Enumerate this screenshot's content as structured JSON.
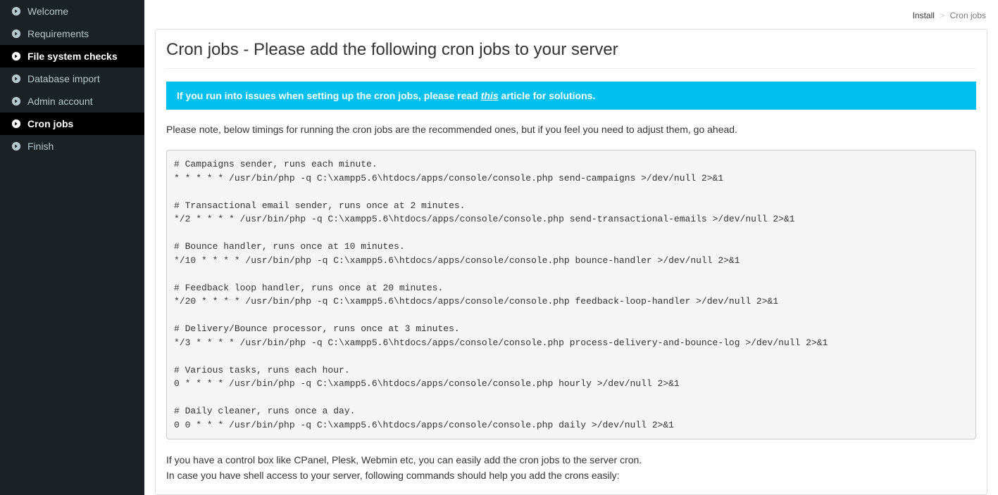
{
  "sidebar": {
    "items": [
      {
        "label": "Welcome",
        "active": false
      },
      {
        "label": "Requirements",
        "active": false
      },
      {
        "label": "File system checks",
        "active": true
      },
      {
        "label": "Database import",
        "active": false
      },
      {
        "label": "Admin account",
        "active": false
      },
      {
        "label": "Cron jobs",
        "active": true
      },
      {
        "label": "Finish",
        "active": false
      }
    ]
  },
  "breadcrumb": {
    "items": [
      "Install",
      "Cron jobs"
    ]
  },
  "page": {
    "title": "Cron jobs - Please add the following cron jobs to your server"
  },
  "alert": {
    "prefix": "If you run into issues when setting up the cron jobs, please read ",
    "link_text": "this",
    "suffix": " article for solutions."
  },
  "note": "Please note, below timings for running the cron jobs are the recommended ones, but if you feel you need to adjust them, go ahead.",
  "code": "# Campaigns sender, runs each minute.\n* * * * * /usr/bin/php -q C:\\xampp5.6\\htdocs/apps/console/console.php send-campaigns >/dev/null 2>&1\n\n# Transactional email sender, runs once at 2 minutes.\n*/2 * * * * /usr/bin/php -q C:\\xampp5.6\\htdocs/apps/console/console.php send-transactional-emails >/dev/null 2>&1\n\n# Bounce handler, runs once at 10 minutes.\n*/10 * * * * /usr/bin/php -q C:\\xampp5.6\\htdocs/apps/console/console.php bounce-handler >/dev/null 2>&1\n\n# Feedback loop handler, runs once at 20 minutes.\n*/20 * * * * /usr/bin/php -q C:\\xampp5.6\\htdocs/apps/console/console.php feedback-loop-handler >/dev/null 2>&1\n\n# Delivery/Bounce processor, runs once at 3 minutes.\n*/3 * * * * /usr/bin/php -q C:\\xampp5.6\\htdocs/apps/console/console.php process-delivery-and-bounce-log >/dev/null 2>&1\n\n# Various tasks, runs each hour.\n0 * * * * /usr/bin/php -q C:\\xampp5.6\\htdocs/apps/console/console.php hourly >/dev/null 2>&1\n\n# Daily cleaner, runs once a day.\n0 0 * * * /usr/bin/php -q C:\\xampp5.6\\htdocs/apps/console/console.php daily >/dev/null 2>&1",
  "footer": {
    "line1": "If you have a control box like CPanel, Plesk, Webmin etc, you can easily add the cron jobs to the server cron.",
    "line2": "In case you have shell access to your server, following commands should help you add the crons easily:"
  }
}
